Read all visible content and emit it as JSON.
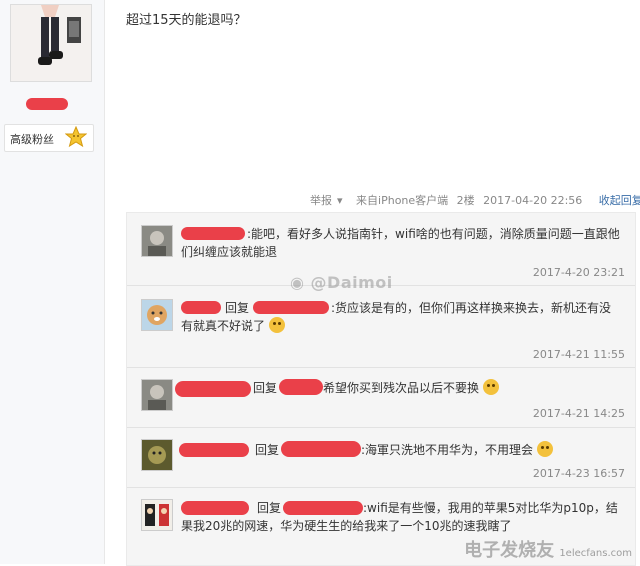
{
  "user": {
    "fan_level": "高级粉丝"
  },
  "post": {
    "text": "超过15天的能退吗？"
  },
  "meta": {
    "report": "举报",
    "source": "来自iPhone客户端",
    "floor": "2楼",
    "time": "2017-04-20 22:56",
    "collapse": "收起回复"
  },
  "replies": [
    {
      "text": ":能吧，看好多人说指南针，wifi啥的也有问题，消除质量问题一直跟他们纠缠应该就能退",
      "time": "2017-4-20 23:21"
    },
    {
      "reply_label": "回复",
      "text": ":货应该是有的，但你们再这样换来换去，新机还有没有就真不好说了",
      "time": "2017-4-21 11:55"
    },
    {
      "reply_label": "回复",
      "text": "希望你买到残次品以后不要换",
      "time": "2017-4-21 14:25"
    },
    {
      "reply_label": "回复",
      "text": ":海軍只洗地不用华为，不用理会",
      "time": "2017-4-23 16:57"
    },
    {
      "reply_label": "回复",
      "text": ":wifi是有些慢，我用的苹果5对比华为p10p，结果我20兆的网速，华为硬生生的给我来了一个10兆的速",
      "text_tail": "我瞎了",
      "time": ""
    }
  ],
  "watermarks": {
    "center": "@Daimoi",
    "corner_logo": "电子发烧友",
    "corner_url": "1elecfans.com"
  }
}
